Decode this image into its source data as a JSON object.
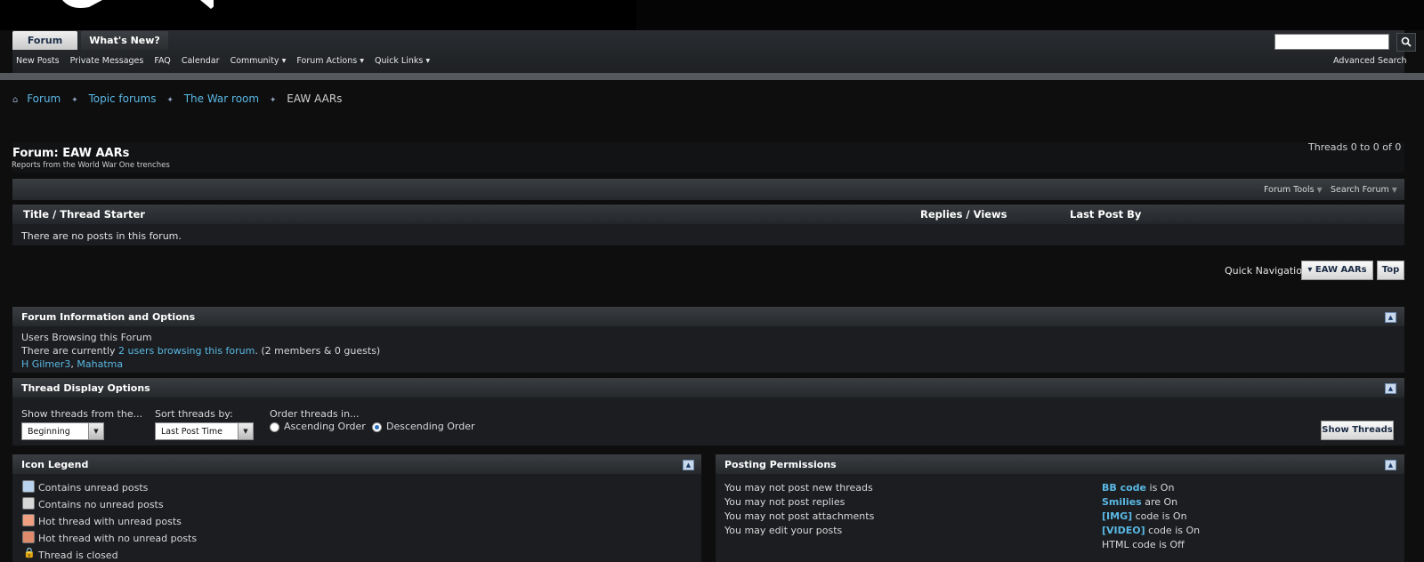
{
  "nav": {
    "tabs": [
      "Forum",
      "What's New?"
    ],
    "subnav": [
      "New Posts",
      "Private Messages",
      "FAQ",
      "Calendar",
      "Community ▾",
      "Forum Actions ▾",
      "Quick Links ▾"
    ],
    "advanced_search": "Advanced Search"
  },
  "breadcrumb": {
    "items": [
      "Forum",
      "Topic forums",
      "The War room",
      "EAW AARs"
    ]
  },
  "forum": {
    "title": "Forum: EAW AARs",
    "description": "Reports from the World War One trenches",
    "thread_count": "Threads 0 to 0 of 0",
    "tools": "Forum Tools",
    "search": "Search Forum",
    "col_title": "Title / Thread Starter",
    "col_replies": "Replies / Views",
    "col_lastpost": "Last Post By",
    "no_posts": "There are no posts in this forum."
  },
  "quicknav": {
    "label": "Quick Navigation",
    "select": "▾ EAW AARs",
    "top": "Top"
  },
  "info": {
    "header": "Forum Information and Options",
    "line1": "Users Browsing this Forum",
    "line2_prefix": "There are currently ",
    "line2_link": "2 users browsing this forum",
    "line2_suffix": ". (2 members & 0 guests)",
    "user1": "H Gilmer3",
    "user2": "Mahatma"
  },
  "display": {
    "header": "Thread Display Options",
    "show_label": "Show threads from the...",
    "show_value": "Beginning",
    "sort_label": "Sort threads by:",
    "sort_value": "Last Post Time",
    "order_label": "Order threads in...",
    "asc": "Ascending Order",
    "desc": "Descending Order",
    "button": "Show Threads"
  },
  "legend": {
    "header": "Icon Legend",
    "items": [
      "Contains unread posts",
      "Contains no unread posts",
      "Hot thread with unread posts",
      "Hot thread with no unread posts",
      "Thread is closed"
    ]
  },
  "permissions": {
    "header": "Posting Permissions",
    "rules": [
      "You may not post new threads",
      "You may not post replies",
      "You may not post attachments",
      "You may edit your posts"
    ],
    "codes": [
      {
        "key": "BB code",
        "val": " is On"
      },
      {
        "key": "Smilies",
        "val": " are On"
      },
      {
        "key": "[IMG]",
        "val": " code is On"
      },
      {
        "key": "[VIDEO]",
        "val": " code is On"
      },
      {
        "key": "",
        "val": "HTML code is Off"
      }
    ]
  }
}
